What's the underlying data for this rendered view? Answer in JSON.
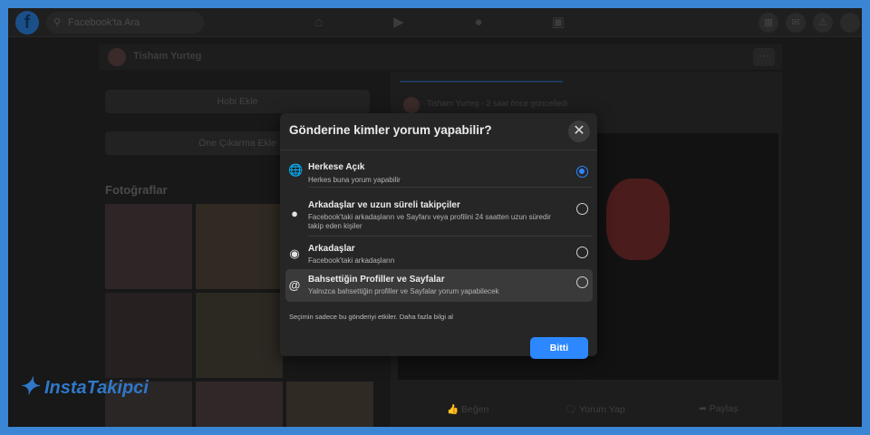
{
  "topbar": {
    "logo": "f",
    "search_placeholder": "Facebook'ta Ara"
  },
  "profile": {
    "name": "Tisham Yurteg"
  },
  "left": {
    "buttons": [
      "Hobi Ekle",
      "Öne Çıkarma Ekle"
    ],
    "photos_title": "Fotoğraflar"
  },
  "post": {
    "header": "Tisham Yurteg · 2 saat önce güncelledi",
    "actions": {
      "like": "Beğen",
      "comment": "Yorum Yap",
      "share": "Paylaş"
    }
  },
  "modal": {
    "title": "Gönderine kimler yorum yapabilir?",
    "options": [
      {
        "icon": "globe-icon",
        "label": "Herkese Açık",
        "desc": "Herkes buna yorum yapabilir",
        "selected": true
      },
      {
        "icon": "person-icon",
        "label": "Arkadaşlar ve uzun süreli takipçiler",
        "desc": "Facebook'taki arkadaşların ve Sayfanı veya profilini 24 saatten uzun süredir takip eden kişiler",
        "selected": false
      },
      {
        "icon": "friends-icon",
        "label": "Arkadaşlar",
        "desc": "Facebook'taki arkadaşların",
        "selected": false
      },
      {
        "icon": "at-icon",
        "label": "Bahsettiğin Profiller ve Sayfalar",
        "desc": "Yalnızca bahsettiğin profiller ve Sayfalar yorum yapabilecek",
        "selected": false
      }
    ],
    "note": "Seçimin sadece bu gönderiyi etkiler. Daha fazla bilgi al",
    "done_label": "Bitti"
  },
  "watermark": "InstaTakipci",
  "colors": {
    "accent": "#2d88ff",
    "border": "#3a86d4",
    "modal_bg": "#262626"
  }
}
